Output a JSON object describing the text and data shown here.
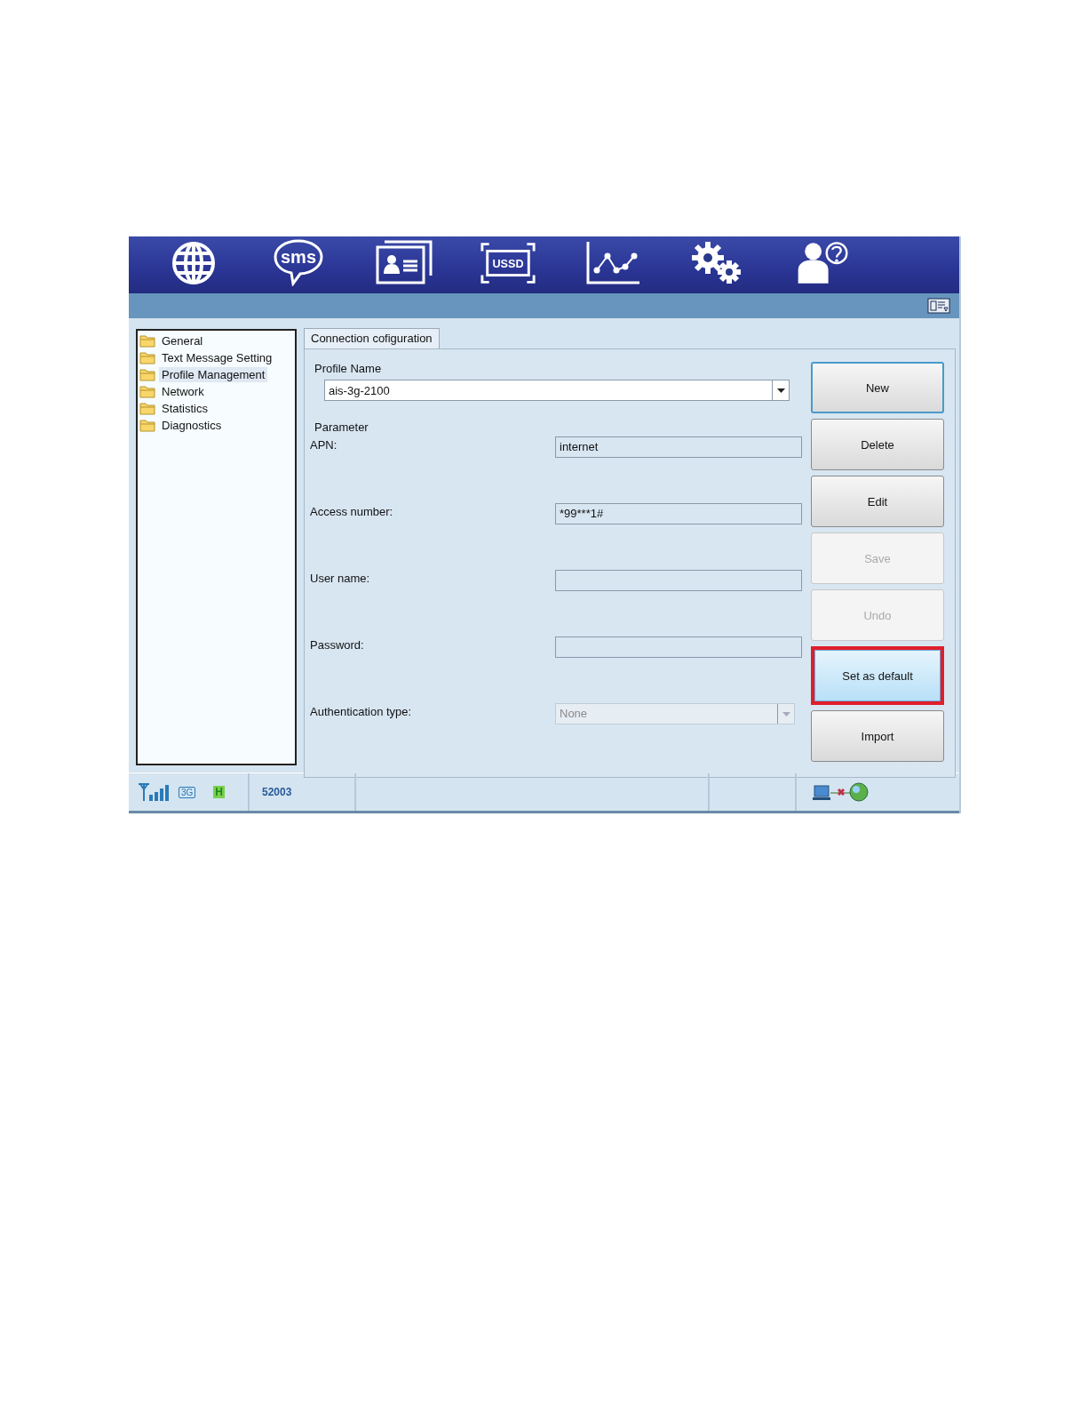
{
  "toolbar": [
    {
      "kind": "globe"
    },
    {
      "kind": "sms",
      "label": "sms"
    },
    {
      "kind": "contacts"
    },
    {
      "kind": "ussd",
      "label": "USSD"
    },
    {
      "kind": "statistics"
    },
    {
      "kind": "settings"
    },
    {
      "kind": "help"
    }
  ],
  "sidebar": {
    "items": [
      {
        "label": "General",
        "selected": false
      },
      {
        "label": "Text Message Setting",
        "selected": false
      },
      {
        "label": "Profile Management",
        "selected": true
      },
      {
        "label": "Network",
        "selected": false
      },
      {
        "label": "Statistics",
        "selected": false
      },
      {
        "label": "Diagnostics",
        "selected": false
      }
    ]
  },
  "tabs": [
    {
      "label": "Connection cofiguration",
      "selected": true
    }
  ],
  "profile": {
    "label": "Profile Name",
    "value": "ais-3g-2100"
  },
  "parameter": {
    "title": "Parameter",
    "fields": [
      {
        "label": "APN:",
        "kind": "text",
        "value": "internet",
        "disabled": false
      },
      {
        "label": "Access number:",
        "kind": "text",
        "value": "*99***1#",
        "disabled": false
      },
      {
        "label": "User name:",
        "kind": "text",
        "disabled": false
      },
      {
        "label": "Password:",
        "kind": "text",
        "disabled": false
      },
      {
        "label": "Authentication type:",
        "kind": "select",
        "value": "None",
        "disabled": true
      }
    ]
  },
  "buttons": [
    {
      "label": "New",
      "focused": true,
      "disabled": false,
      "highlighted": false,
      "marked": false
    },
    {
      "label": "Delete",
      "focused": false,
      "disabled": false,
      "highlighted": false,
      "marked": false
    },
    {
      "label": "Edit",
      "focused": false,
      "disabled": false,
      "highlighted": false,
      "marked": false
    },
    {
      "label": "Save",
      "focused": false,
      "disabled": true,
      "highlighted": false,
      "marked": false
    },
    {
      "label": "Undo",
      "focused": false,
      "disabled": true,
      "highlighted": false,
      "marked": false
    },
    {
      "label": "Set as default",
      "focused": false,
      "disabled": false,
      "highlighted": true,
      "marked": true
    },
    {
      "label": "Import",
      "focused": false,
      "disabled": false,
      "highlighted": false,
      "marked": false
    }
  ],
  "status_bar": {
    "network_type": "3G",
    "mode": "H",
    "operator": "52003"
  }
}
